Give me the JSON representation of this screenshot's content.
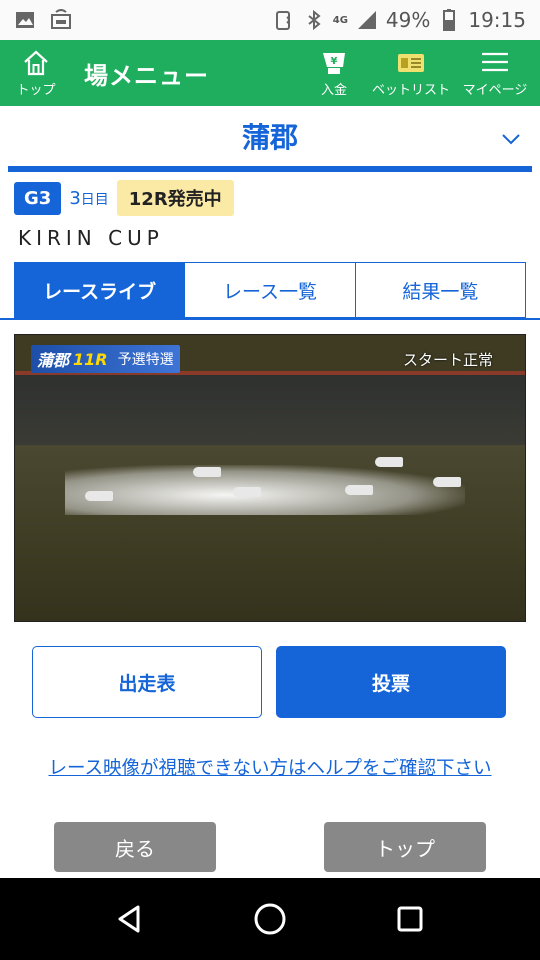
{
  "status_bar": {
    "battery": "49%",
    "time": "19:15",
    "network": "4G"
  },
  "app_bar": {
    "home_label": "トップ",
    "title": "場メニュー",
    "deposit_label": "入金",
    "betlist_label": "ベットリスト",
    "mypage_label": "マイページ"
  },
  "venue": {
    "name": "蒲郡"
  },
  "race_info": {
    "grade": "G3",
    "day_number": "3",
    "day_suffix": "日目",
    "selling": "12R発売中",
    "cup_name": "KIRIN CUP"
  },
  "tabs": [
    {
      "label": "レースライブ",
      "active": true
    },
    {
      "label": "レース一覧",
      "active": false
    },
    {
      "label": "結果一覧",
      "active": false
    }
  ],
  "video": {
    "venue_tag": "蒲郡",
    "race_tag": "11R",
    "race_type": "予選特選",
    "status": "スタート正常"
  },
  "actions": {
    "program_label": "出走表",
    "vote_label": "投票"
  },
  "help_link": "レース映像が視聴できない方はヘルプをご確認下さい",
  "bottom": {
    "back_label": "戻る",
    "top_label": "トップ"
  },
  "colors": {
    "app_bar": "#1fae5e",
    "accent": "#1565d8",
    "selling_bg": "#fbe9a6"
  }
}
